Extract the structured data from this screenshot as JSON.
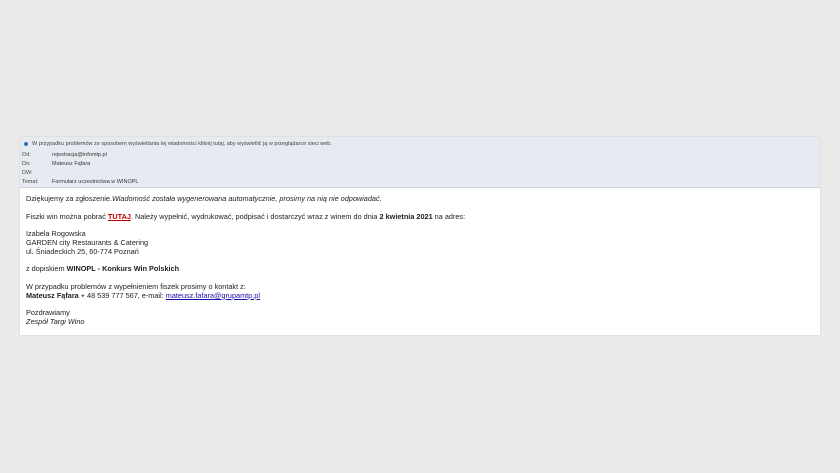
{
  "header": {
    "info_text": "W przypadku problemów ze sposobem wyświetlania tej wiadomości kliknij tutaj, aby wyświetlić ją w przeglądarce sieci web.",
    "from_label": "Od:",
    "from_value": "rejestracja@infomtp.pl",
    "to_label": "Do:",
    "to_value": "Mateusz Fąfara",
    "cc_label": "DW:",
    "cc_value": "",
    "subject_label": "Temat:",
    "subject_value": "Formularz uczestnictwa w  WINOPL"
  },
  "body": {
    "thanks": "Dziękujemy za zgłoszenie.",
    "auto_note": "Wiadomość została wygenerowana automatycznie, prosimy na nią nie odpowiadać.",
    "download_pre": "Fiszki win można pobrać ",
    "download_link": "TUTAJ",
    "download_mid": ". Należy wypełnić, wydrukować, podpisać i dostarczyć wraz z winem do dnia ",
    "deadline": "2 kwietnia 2021",
    "download_post": " na adres:",
    "address_name": "Izabela Rogowska",
    "address_company": "GARDEN city Restaurants & Catering",
    "address_street": "ul. Śniadeckich 25, 60-774 Poznań",
    "note_pre": "z dopiskiem ",
    "note_bold": "WINOPL - Konkurs Win Polskich",
    "contact_intro": "W przypadku problemów z wypełnieniem fiszek prosimy o kontakt z:",
    "contact_name": "Mateusz Fąfara",
    "contact_phone": " + 48 539 777 567, e-mail: ",
    "contact_email": "mateusz.fafara@grupamtp.pl",
    "greeting": "Pozdrawiamy",
    "signature": "Zespół Targi Wino"
  }
}
